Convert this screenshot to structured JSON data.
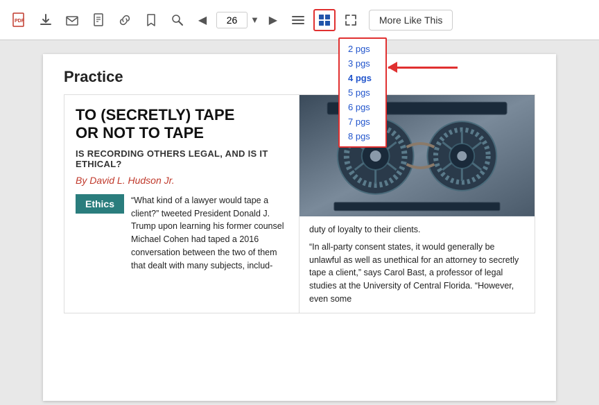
{
  "toolbar": {
    "page_number": "26",
    "more_like_this_label": "More Like This",
    "dropdown_items": [
      "2 pgs",
      "3 pgs",
      "4 pgs",
      "5 pgs",
      "6 pgs",
      "7 pgs",
      "8 pgs"
    ]
  },
  "article": {
    "section": "Practice",
    "title_line1": "TO (SECRETLY) TAPE",
    "title_line2": "OR NOT TO TAPE",
    "subtitle": "IS RECORDING OTHERS LEGAL, AND IS IT ETHICAL?",
    "author": "By David L. Hudson Jr.",
    "ethics_badge": "Ethics",
    "ethics_text_1": "“What kind of a lawyer would tape a client?” tweeted President Donald J. Trump upon learning his former counsel Michael Cohen had taped a 2016 conversation between the two of them that dealt with many subjects, includ-",
    "right_text_1": "duty of loyalty to their clients.",
    "right_text_2": "“In all-party consent states, it would generally be unlawful as well as unethical for an attorney to secretly tape a client,” says Carol Bast, a professor of legal studies at the University of Central Florida. “However, even some"
  }
}
